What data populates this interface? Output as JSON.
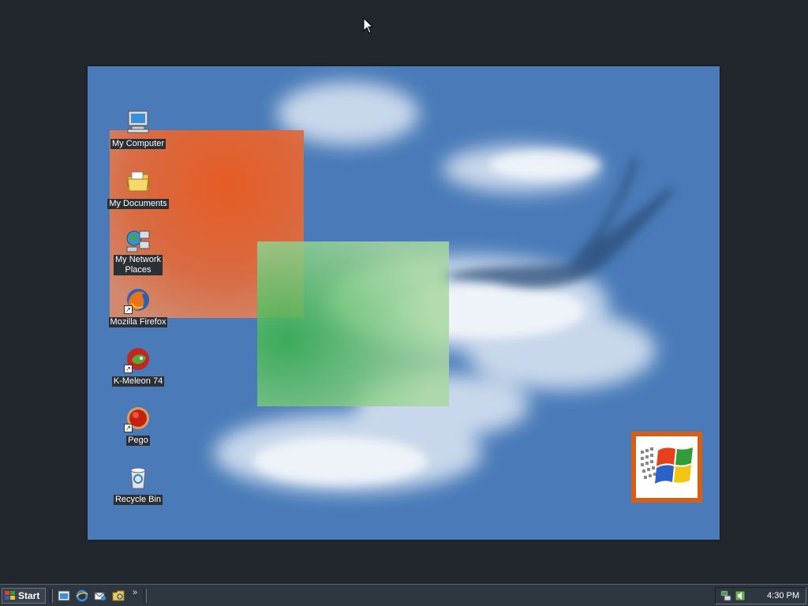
{
  "desktop": {
    "icons": [
      {
        "label": "My Computer",
        "icon": "computer-icon"
      },
      {
        "label": "My Documents",
        "icon": "folder-documents-icon"
      },
      {
        "label": "My Network\nPlaces",
        "icon": "network-places-icon"
      },
      {
        "label": "Mozilla Firefox",
        "icon": "firefox-icon",
        "shortcut": true
      },
      {
        "label": "K-Meleon 74",
        "icon": "k-meleon-icon",
        "shortcut": true
      },
      {
        "label": "Pego",
        "icon": "pego-icon",
        "shortcut": true
      },
      {
        "label": "Recycle Bin",
        "icon": "recycle-bin-icon"
      }
    ]
  },
  "taskbar": {
    "start_label": "Start",
    "quick_launch_more": "»",
    "clock": "4:30 PM"
  },
  "colors": {
    "desktop_dark": "#22262d",
    "wallpaper_sky": "#4a7bb8",
    "orange_square": "#e8622a",
    "green_square": "#7cc47a",
    "taskbar": "#2e3640"
  }
}
